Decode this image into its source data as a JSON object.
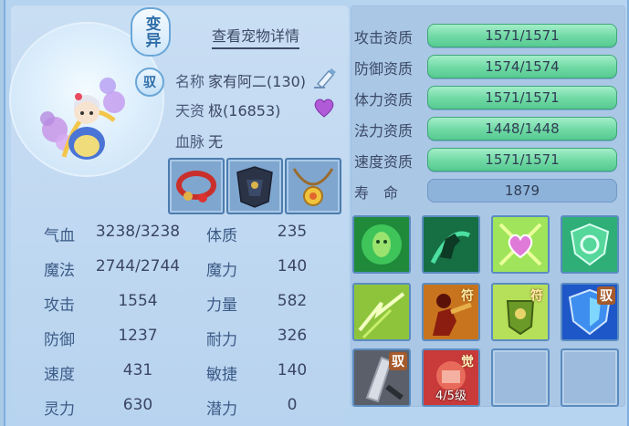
{
  "pet": {
    "mutate_badge": "变异",
    "bind_badge": "驭",
    "detail_title": "查看宠物详情",
    "name_label": "名称",
    "name_value": "家有阿二(130)",
    "talent_label": "天资",
    "talent_value": "极(16853)",
    "bloodline_label": "血脉",
    "bloodline_value": "无"
  },
  "equipment": [
    {
      "name": "red-beaded-bracelet"
    },
    {
      "name": "dark-armor"
    },
    {
      "name": "gold-necklace"
    }
  ],
  "stats": [
    {
      "label": "气血",
      "value": "3238/3238",
      "label2": "体质",
      "value2": "235"
    },
    {
      "label": "魔法",
      "value": "2744/2744",
      "label2": "魔力",
      "value2": "140"
    },
    {
      "label": "攻击",
      "value": "1554",
      "label2": "力量",
      "value2": "582"
    },
    {
      "label": "防御",
      "value": "1237",
      "label2": "耐力",
      "value2": "326"
    },
    {
      "label": "速度",
      "value": "431",
      "label2": "敏捷",
      "value2": "140"
    },
    {
      "label": "灵力",
      "value": "630",
      "label2": "潜力",
      "value2": "0"
    }
  ],
  "aptitudes": [
    {
      "label": "攻击资质",
      "value": "1571/1571"
    },
    {
      "label": "防御资质",
      "value": "1574/1574"
    },
    {
      "label": "体力资质",
      "value": "1571/1571"
    },
    {
      "label": "法力资质",
      "value": "1448/1448"
    },
    {
      "label": "速度资质",
      "value": "1571/1571"
    }
  ],
  "life": {
    "label": "寿　命",
    "value": "1879"
  },
  "skills": [
    {
      "icon": "green-ghost-icon"
    },
    {
      "icon": "green-horse-icon"
    },
    {
      "icon": "pink-heart-icon"
    },
    {
      "icon": "green-shield-icon"
    },
    {
      "icon": "green-lightning-icon"
    },
    {
      "icon": "red-figure-icon",
      "tag": "符"
    },
    {
      "icon": "green-armor-icon",
      "tag": "符"
    },
    {
      "icon": "blue-shield-icon",
      "tag": "驭"
    },
    {
      "icon": "silver-blade-icon",
      "tag": "驭"
    },
    {
      "icon": "red-fist-icon",
      "tag": "觉",
      "level": "4/5级"
    },
    {
      "icon": "empty"
    },
    {
      "icon": "empty"
    }
  ],
  "colors": {
    "background": "#b6d3ef",
    "aptitude_bar": "#6fd9a4",
    "text": "#3a4662"
  }
}
